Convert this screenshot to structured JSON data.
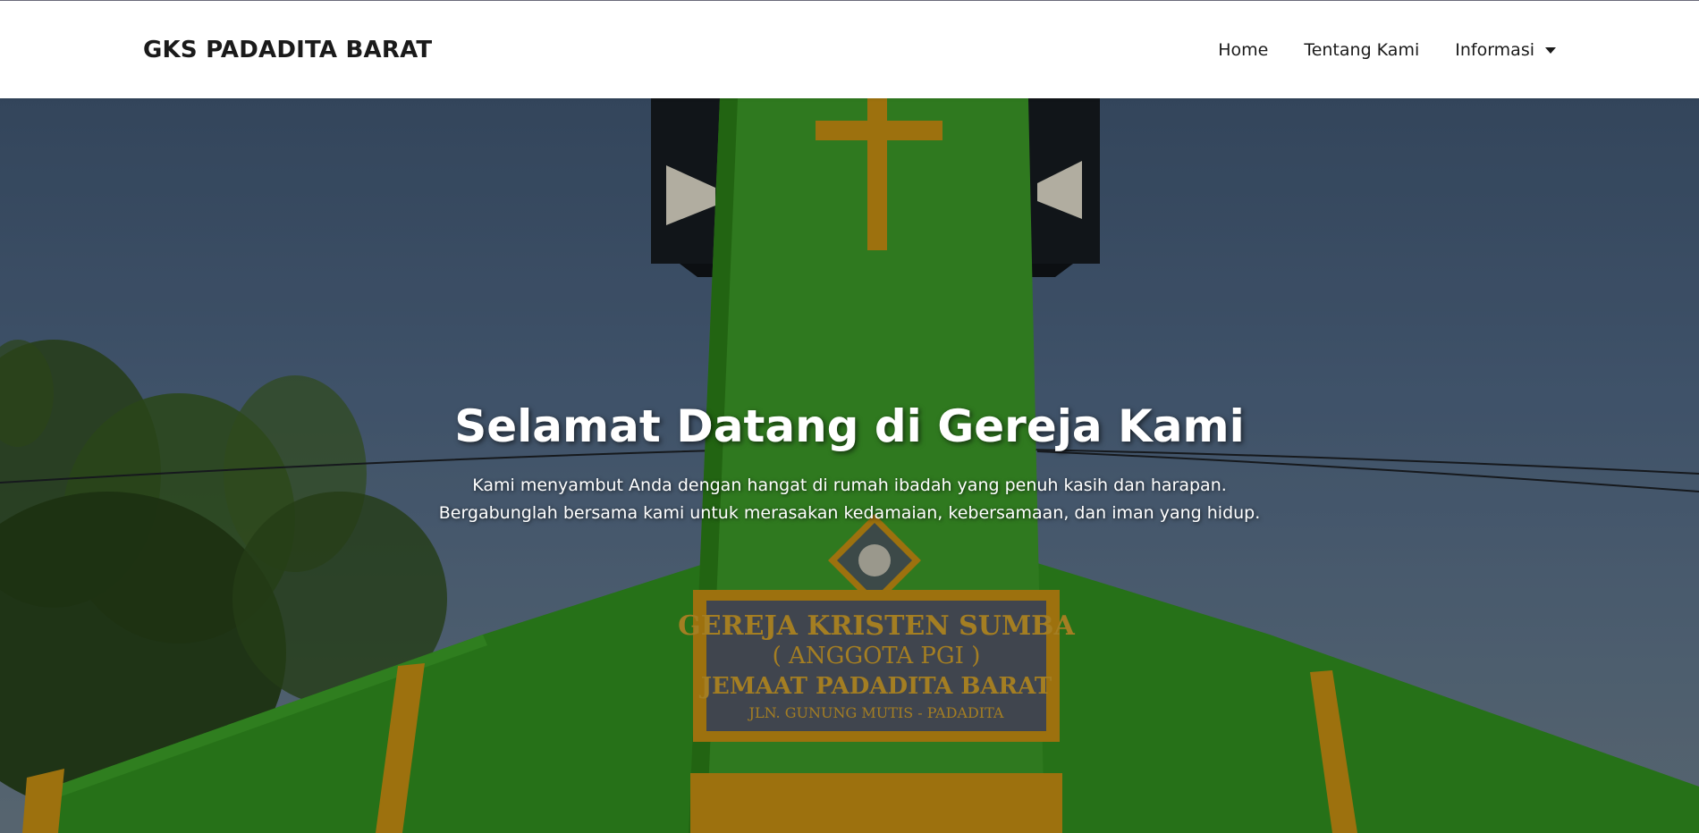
{
  "navbar": {
    "brand": "GKS PADADITA BARAT",
    "links": [
      {
        "label": "Home"
      },
      {
        "label": "Tentang Kami"
      },
      {
        "label": "Informasi"
      }
    ]
  },
  "hero": {
    "title": "Selamat Datang di Gereja Kami",
    "text": "Kami menyambut Anda dengan hangat di rumah ibadah yang penuh kasih dan harapan. Bergabunglah bersama kami untuk merasakan kedamaian, kebersamaan, dan iman yang hidup.",
    "sign": {
      "line1": "GEREJA KRISTEN SUMBA",
      "line2": "( ANGGOTA PGI )",
      "line3": "JEMAAT PADADITA BARAT",
      "line4": "JLN. GUNUNG MUTIS - PADADITA"
    }
  },
  "colors": {
    "church_green": "#2f8a1e",
    "trim_gold": "#b07d12",
    "sky": "#4d6480"
  }
}
